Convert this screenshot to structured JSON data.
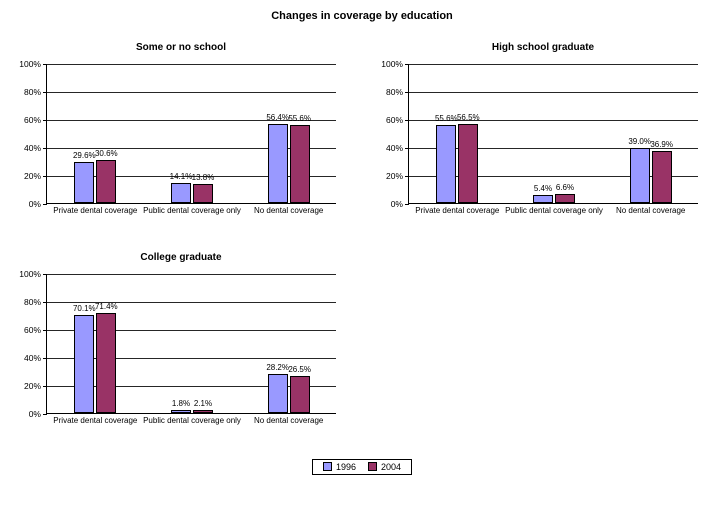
{
  "title": "Changes in coverage by education",
  "legend": {
    "s1": "1996",
    "s2": "2004"
  },
  "colors": {
    "s1": "#9999ff",
    "s2": "#993366"
  },
  "ylim": [
    0,
    100
  ],
  "yticks": [
    0,
    20,
    40,
    60,
    80,
    100
  ],
  "categories": [
    "Private dental coverage",
    "Public dental coverage only",
    "No dental coverage"
  ],
  "chart_data": [
    {
      "type": "bar",
      "subtitle": "Some or no school",
      "series": [
        {
          "name": "1996",
          "values": [
            29.6,
            14.1,
            56.4
          ]
        },
        {
          "name": "2004",
          "values": [
            30.6,
            13.8,
            55.6
          ]
        }
      ]
    },
    {
      "type": "bar",
      "subtitle": "High school graduate",
      "series": [
        {
          "name": "1996",
          "values": [
            55.6,
            5.4,
            39.0
          ]
        },
        {
          "name": "2004",
          "values": [
            56.5,
            6.6,
            36.9
          ]
        }
      ]
    },
    {
      "type": "bar",
      "subtitle": "College graduate",
      "series": [
        {
          "name": "1996",
          "values": [
            70.1,
            1.8,
            28.2
          ]
        },
        {
          "name": "2004",
          "values": [
            71.4,
            2.1,
            26.5
          ]
        }
      ]
    }
  ]
}
